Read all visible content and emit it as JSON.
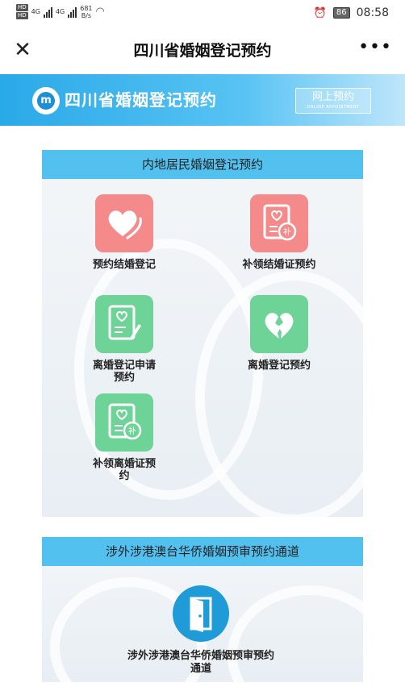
{
  "status_bar": {
    "hd_labels": [
      "HD",
      "HD"
    ],
    "network_1": "4G",
    "network_2": "4G",
    "speed_value": "681",
    "speed_unit": "B/s",
    "battery": "86",
    "time": "08:58"
  },
  "title_bar": {
    "title": "四川省婚姻登记预约"
  },
  "banner": {
    "title": "四川省婚姻登记预约",
    "online_label": "网上预约",
    "online_sub": "ONLINE APPOINTMENT"
  },
  "mainland_section": {
    "header": "内地居民婚姻登记预约",
    "items": [
      {
        "label": "预约结婚登记",
        "icon": "heart-icon",
        "color": "#f48a8a"
      },
      {
        "label": "补领结婚证预约",
        "icon": "certificate-heart-icon",
        "color": "#f48a8a"
      },
      {
        "label": "离婚登记申请预约",
        "icon": "document-heart-icon",
        "color": "#6dd396"
      },
      {
        "label": "离婚登记预约",
        "icon": "broken-heart-icon",
        "color": "#6dd396"
      },
      {
        "label": "补领离婚证预约",
        "icon": "certificate-heart-icon",
        "color": "#6dd396"
      }
    ],
    "badge_char": "补"
  },
  "foreign_section": {
    "header": "涉外涉港澳台华侨婚姻预审预约通道",
    "item_label": "涉外涉港澳台华侨婚姻预审预约通道",
    "icon": "door-icon",
    "color": "#1f9bd7"
  }
}
